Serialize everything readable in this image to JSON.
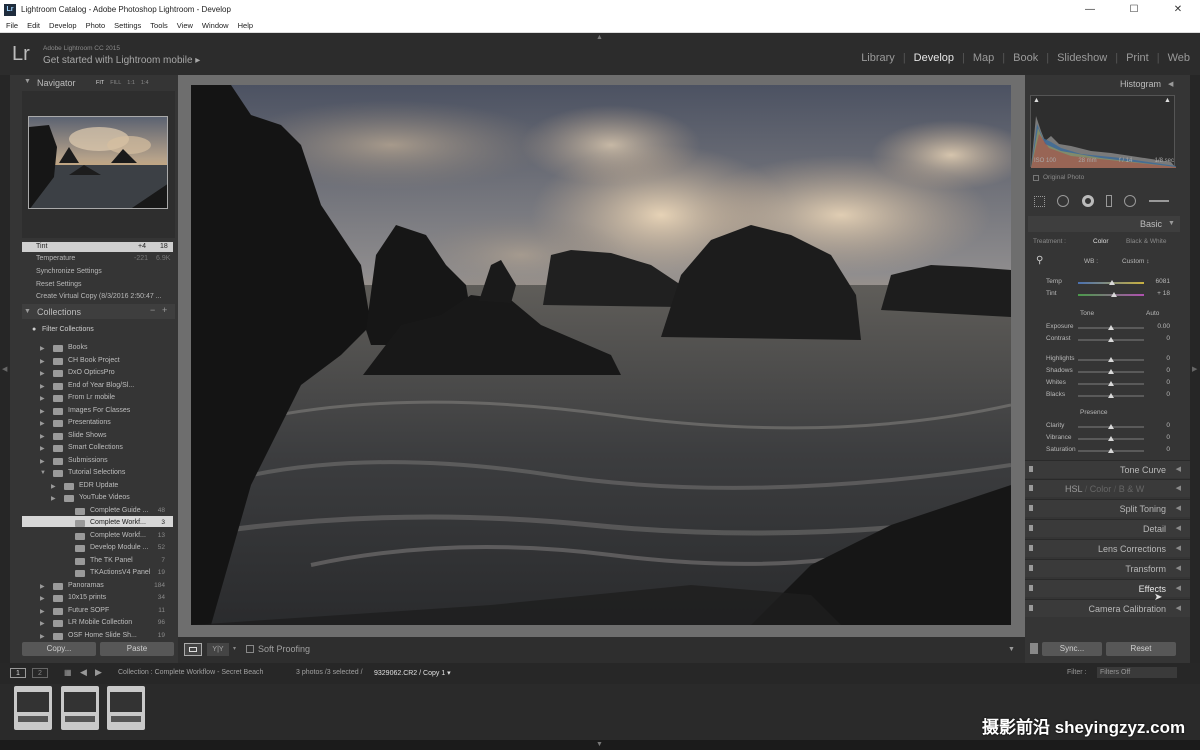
{
  "window": {
    "title": "Lightroom Catalog - Adobe Photoshop Lightroom - Develop",
    "controls": [
      "—",
      "☐",
      "✕"
    ]
  },
  "menu": [
    "File",
    "Edit",
    "Develop",
    "Photo",
    "Settings",
    "Tools",
    "View",
    "Window",
    "Help"
  ],
  "header": {
    "logo": "Lr",
    "version": "Adobe Lightroom CC 2015",
    "mobile_link": "Get started with Lightroom mobile ▸",
    "modules": [
      "Library",
      "Develop",
      "Map",
      "Book",
      "Slideshow",
      "Print",
      "Web"
    ],
    "active_module": "Develop"
  },
  "navigator": {
    "title": "Navigator",
    "zoom": [
      "FIT",
      "FILL",
      "1:1",
      "1:4"
    ]
  },
  "history": [
    {
      "label": "Tint",
      "a": "+4",
      "b": "18"
    },
    {
      "label": "Temperature",
      "a": "-221",
      "b": "6.9K"
    },
    {
      "label": "Synchronize Settings",
      "a": "",
      "b": ""
    },
    {
      "label": "Reset Settings",
      "a": "",
      "b": ""
    },
    {
      "label": "Create Virtual Copy (8/3/2016 2:50:47 ...",
      "a": "",
      "b": ""
    }
  ],
  "collections": {
    "title": "Collections",
    "filter": "Filter Collections",
    "items": [
      {
        "label": "Books",
        "count": "",
        "level": 0
      },
      {
        "label": "CH Book Project",
        "count": "",
        "level": 0
      },
      {
        "label": "DxO OpticsPro",
        "count": "",
        "level": 0
      },
      {
        "label": "End of Year Blog/Sl...",
        "count": "",
        "level": 0
      },
      {
        "label": "From Lr mobile",
        "count": "",
        "level": 0
      },
      {
        "label": "Images For Classes",
        "count": "",
        "level": 0
      },
      {
        "label": "Presentations",
        "count": "",
        "level": 0
      },
      {
        "label": "Slide Shows",
        "count": "",
        "level": 0
      },
      {
        "label": "Smart Collections",
        "count": "",
        "level": 0
      },
      {
        "label": "Submissions",
        "count": "",
        "level": 0
      },
      {
        "label": "Tutorial Selections",
        "count": "",
        "level": 0
      },
      {
        "label": "EDR Update",
        "count": "",
        "level": 1
      },
      {
        "label": "YouTube Videos",
        "count": "",
        "level": 1
      },
      {
        "label": "Complete Guide ...",
        "count": "48",
        "level": 2
      },
      {
        "label": "Complete Workf...",
        "count": "3",
        "level": 2
      },
      {
        "label": "Complete Workf...",
        "count": "13",
        "level": 2
      },
      {
        "label": "Develop Module ...",
        "count": "52",
        "level": 2
      },
      {
        "label": "The TK Panel",
        "count": "7",
        "level": 2
      },
      {
        "label": "TKActionsV4 Panel",
        "count": "19",
        "level": 2
      },
      {
        "label": "Panoramas",
        "count": "184",
        "level": 0
      },
      {
        "label": "10x15 prints",
        "count": "34",
        "level": 0
      },
      {
        "label": "Future SOPF",
        "count": "11",
        "level": 0
      },
      {
        "label": "LR Mobile Collection",
        "count": "96",
        "level": 0
      },
      {
        "label": "OSF Home Slide Sh...",
        "count": "19",
        "level": 0
      }
    ]
  },
  "left_buttons": {
    "copy": "Copy...",
    "paste": "Paste"
  },
  "toolbar": {
    "soft_proofing": "Soft Proofing"
  },
  "histogram": {
    "title": "Histogram",
    "info": [
      "ISO 100",
      "28 mm",
      "f / 14",
      "1/8 sec"
    ],
    "original_photo": "Original Photo"
  },
  "basic": {
    "title": "Basic",
    "treatment_label": "Treatment :",
    "color": "Color",
    "bw": "Black & White",
    "wb_label": "WB :",
    "wb_value": "Custom ↕",
    "temp": {
      "label": "Temp",
      "value": "6081",
      "pos": 0.52
    },
    "tint": {
      "label": "Tint",
      "value": "+ 18",
      "pos": 0.54
    },
    "tone_label": "Tone",
    "auto": "Auto",
    "tone": [
      {
        "label": "Exposure",
        "value": "0.00",
        "pos": 0.5
      },
      {
        "label": "Contrast",
        "value": "0",
        "pos": 0.5
      },
      {
        "label": "Highlights",
        "value": "0",
        "pos": 0.5
      },
      {
        "label": "Shadows",
        "value": "0",
        "pos": 0.5
      },
      {
        "label": "Whites",
        "value": "0",
        "pos": 0.5
      },
      {
        "label": "Blacks",
        "value": "0",
        "pos": 0.5
      }
    ],
    "presence_label": "Presence",
    "presence": [
      {
        "label": "Clarity",
        "value": "0",
        "pos": 0.5
      },
      {
        "label": "Vibrance",
        "value": "0",
        "pos": 0.5
      },
      {
        "label": "Saturation",
        "value": "0",
        "pos": 0.5
      }
    ]
  },
  "hsl": {
    "hsl": "HSL",
    "color": "Color",
    "bw": "B & W"
  },
  "panels": [
    "Tone Curve",
    "Split Toning",
    "Detail",
    "Lens Corrections",
    "Transform",
    "Effects",
    "Camera Calibration"
  ],
  "right_buttons": {
    "sync": "Sync...",
    "reset": "Reset"
  },
  "filmbar": {
    "pages": [
      "1",
      "2"
    ],
    "source": "Collection : Complete Workflow - Secret Beach",
    "selection": "3 photos /3 selected /",
    "file": "9329062.CR2 / Copy 1 ▾",
    "filter_label": "Filter :",
    "filter_value": "Filters Off"
  },
  "watermark": "摄影前沿 sheyingzyz.com"
}
